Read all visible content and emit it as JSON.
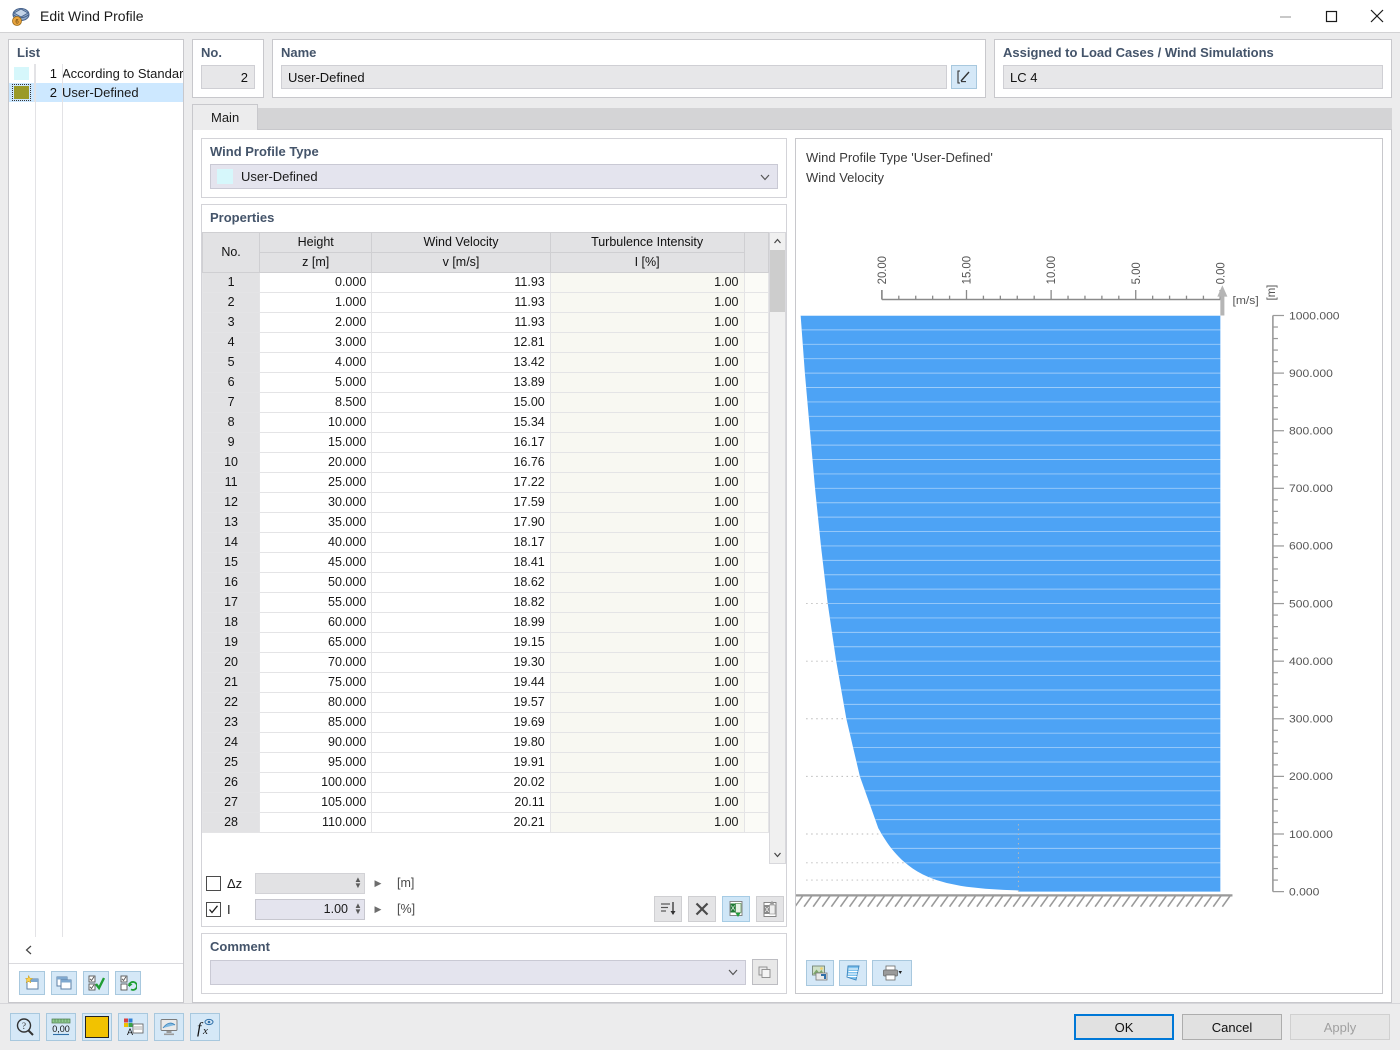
{
  "window": {
    "title": "Edit Wind Profile",
    "icon": "wind-profile-icon",
    "minimize": "minimize-icon",
    "maximize": "maximize-icon",
    "close": "close-icon"
  },
  "list_panel": {
    "header": "List",
    "items": [
      {
        "no": "1",
        "label": "According to Standard",
        "color": "#d6f7fb",
        "selected": false
      },
      {
        "no": "2",
        "label": "User-Defined",
        "color": "#9a9a28",
        "selected": true
      }
    ],
    "collapse": "chevron-left-icon",
    "toolbar": [
      {
        "name": "new-icon"
      },
      {
        "name": "copy-icon"
      },
      {
        "name": "select-all-icon"
      },
      {
        "name": "invert-selection-icon"
      }
    ]
  },
  "no_group": {
    "header": "No.",
    "value": "2"
  },
  "name_group": {
    "header": "Name",
    "value": "User-Defined",
    "edit_icon": "rename-icon"
  },
  "assigned_group": {
    "header": "Assigned to Load Cases / Wind Simulations",
    "value": "LC 4"
  },
  "tabs": [
    {
      "label": "Main",
      "active": true
    }
  ],
  "wind_profile_type": {
    "header": "Wind Profile Type",
    "selected": "User-Defined",
    "swatch": "#d6f7fb",
    "chevron": "chevron-down-icon"
  },
  "properties": {
    "header": "Properties",
    "columns": [
      {
        "title": "No.",
        "unit": ""
      },
      {
        "title": "Height",
        "unit": "z [m]"
      },
      {
        "title": "Wind Velocity",
        "unit": "v [m/s]"
      },
      {
        "title": "Turbulence Intensity",
        "unit": "I [%]"
      }
    ],
    "rows": [
      {
        "no": "1",
        "z": "0.000",
        "v": "11.93",
        "i": "1.00"
      },
      {
        "no": "2",
        "z": "1.000",
        "v": "11.93",
        "i": "1.00"
      },
      {
        "no": "3",
        "z": "2.000",
        "v": "11.93",
        "i": "1.00"
      },
      {
        "no": "4",
        "z": "3.000",
        "v": "12.81",
        "i": "1.00"
      },
      {
        "no": "5",
        "z": "4.000",
        "v": "13.42",
        "i": "1.00"
      },
      {
        "no": "6",
        "z": "5.000",
        "v": "13.89",
        "i": "1.00"
      },
      {
        "no": "7",
        "z": "8.500",
        "v": "15.00",
        "i": "1.00"
      },
      {
        "no": "8",
        "z": "10.000",
        "v": "15.34",
        "i": "1.00"
      },
      {
        "no": "9",
        "z": "15.000",
        "v": "16.17",
        "i": "1.00"
      },
      {
        "no": "10",
        "z": "20.000",
        "v": "16.76",
        "i": "1.00"
      },
      {
        "no": "11",
        "z": "25.000",
        "v": "17.22",
        "i": "1.00"
      },
      {
        "no": "12",
        "z": "30.000",
        "v": "17.59",
        "i": "1.00"
      },
      {
        "no": "13",
        "z": "35.000",
        "v": "17.90",
        "i": "1.00"
      },
      {
        "no": "14",
        "z": "40.000",
        "v": "18.17",
        "i": "1.00"
      },
      {
        "no": "15",
        "z": "45.000",
        "v": "18.41",
        "i": "1.00"
      },
      {
        "no": "16",
        "z": "50.000",
        "v": "18.62",
        "i": "1.00"
      },
      {
        "no": "17",
        "z": "55.000",
        "v": "18.82",
        "i": "1.00"
      },
      {
        "no": "18",
        "z": "60.000",
        "v": "18.99",
        "i": "1.00"
      },
      {
        "no": "19",
        "z": "65.000",
        "v": "19.15",
        "i": "1.00"
      },
      {
        "no": "20",
        "z": "70.000",
        "v": "19.30",
        "i": "1.00"
      },
      {
        "no": "21",
        "z": "75.000",
        "v": "19.44",
        "i": "1.00"
      },
      {
        "no": "22",
        "z": "80.000",
        "v": "19.57",
        "i": "1.00"
      },
      {
        "no": "23",
        "z": "85.000",
        "v": "19.69",
        "i": "1.00"
      },
      {
        "no": "24",
        "z": "90.000",
        "v": "19.80",
        "i": "1.00"
      },
      {
        "no": "25",
        "z": "95.000",
        "v": "19.91",
        "i": "1.00"
      },
      {
        "no": "26",
        "z": "100.000",
        "v": "20.02",
        "i": "1.00"
      },
      {
        "no": "27",
        "z": "105.000",
        "v": "20.11",
        "i": "1.00"
      },
      {
        "no": "28",
        "z": "110.000",
        "v": "20.21",
        "i": "1.00"
      }
    ]
  },
  "param_controls": {
    "delta_z": {
      "checked": false,
      "label": "Δz",
      "value": "",
      "unit": "[m]",
      "enabled": false
    },
    "intensity": {
      "checked": true,
      "label": "I",
      "value": "1.00",
      "unit": "[%]",
      "enabled": true
    },
    "buttons": [
      {
        "name": "sort-icon",
        "highlight": false
      },
      {
        "name": "delete-icon",
        "highlight": false
      },
      {
        "name": "import-excel-icon",
        "highlight": true
      },
      {
        "name": "export-excel-icon",
        "highlight": false
      }
    ]
  },
  "comment": {
    "header": "Comment",
    "value": "",
    "chevron": "chevron-down-icon",
    "copy_icon": "copy-comment-icon"
  },
  "chart_panel": {
    "title_line1": "Wind Profile Type 'User-Defined'",
    "title_line2": "Wind Velocity",
    "toolbar": [
      {
        "name": "print-preview-icon"
      },
      {
        "name": "render-icon"
      },
      {
        "name": "print-icon"
      },
      {
        "name": "print-dropdown-icon"
      }
    ]
  },
  "chart_data": {
    "type": "area",
    "title": "Wind Profile Type 'User-Defined' — Wind Velocity",
    "xlabel": "[m/s]",
    "ylabel": "[m]",
    "xlim": [
      20,
      0
    ],
    "ylim": [
      0,
      1000
    ],
    "x_reversed": true,
    "xticks": [
      "20.00",
      "15.00",
      "10.00",
      "5.00",
      "0.00"
    ],
    "xtick_values": [
      20,
      15,
      10,
      5,
      0
    ],
    "yticks": [
      "0.000",
      "100.000",
      "200.000",
      "300.000",
      "400.000",
      "500.000",
      "600.000",
      "700.000",
      "800.000",
      "900.000",
      "1000.000"
    ],
    "ytick_values": [
      0,
      100,
      200,
      300,
      400,
      500,
      600,
      700,
      800,
      900,
      1000
    ],
    "grid": true,
    "legend": "none",
    "series": [
      {
        "name": "Wind Velocity v",
        "x_name": "v [m/s]",
        "y_name": "z [m]",
        "fill": "#4da3f5",
        "points": [
          {
            "z": 0,
            "v": 11.93
          },
          {
            "z": 1,
            "v": 11.93
          },
          {
            "z": 2,
            "v": 11.93
          },
          {
            "z": 3,
            "v": 12.81
          },
          {
            "z": 4,
            "v": 13.42
          },
          {
            "z": 5,
            "v": 13.89
          },
          {
            "z": 8.5,
            "v": 15.0
          },
          {
            "z": 10,
            "v": 15.34
          },
          {
            "z": 15,
            "v": 16.17
          },
          {
            "z": 20,
            "v": 16.76
          },
          {
            "z": 25,
            "v": 17.22
          },
          {
            "z": 30,
            "v": 17.59
          },
          {
            "z": 35,
            "v": 17.9
          },
          {
            "z": 40,
            "v": 18.17
          },
          {
            "z": 45,
            "v": 18.41
          },
          {
            "z": 50,
            "v": 18.62
          },
          {
            "z": 55,
            "v": 18.82
          },
          {
            "z": 60,
            "v": 18.99
          },
          {
            "z": 65,
            "v": 19.15
          },
          {
            "z": 70,
            "v": 19.3
          },
          {
            "z": 75,
            "v": 19.44
          },
          {
            "z": 80,
            "v": 19.57
          },
          {
            "z": 85,
            "v": 19.69
          },
          {
            "z": 90,
            "v": 19.8
          },
          {
            "z": 95,
            "v": 19.91
          },
          {
            "z": 100,
            "v": 20.02
          },
          {
            "z": 105,
            "v": 20.11
          },
          {
            "z": 110,
            "v": 20.21
          },
          {
            "z": 200,
            "v": 21.3
          },
          {
            "z": 300,
            "v": 22.1
          },
          {
            "z": 400,
            "v": 22.7
          },
          {
            "z": 500,
            "v": 23.2
          },
          {
            "z": 600,
            "v": 23.6
          },
          {
            "z": 700,
            "v": 23.95
          },
          {
            "z": 800,
            "v": 24.25
          },
          {
            "z": 900,
            "v": 24.55
          },
          {
            "z": 1000,
            "v": 24.8
          }
        ]
      }
    ]
  },
  "footer": {
    "tools": [
      {
        "name": "help-icon"
      },
      {
        "name": "units-icon"
      },
      {
        "name": "color-swatch-icon",
        "color": "#f2c200"
      },
      {
        "name": "display-properties-icon"
      },
      {
        "name": "view-icon"
      },
      {
        "name": "formula-icon"
      }
    ],
    "ok": "OK",
    "cancel": "Cancel",
    "apply": "Apply"
  }
}
